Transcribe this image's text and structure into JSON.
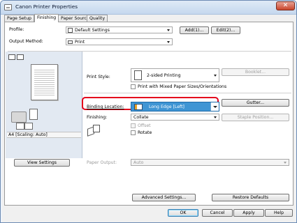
{
  "window": {
    "title": "Canon Printer Properties",
    "close_label": "✕"
  },
  "tabs": [
    {
      "label": "Page Setup"
    },
    {
      "label": "Finishing"
    },
    {
      "label": "Paper Source"
    },
    {
      "label": "Quality"
    }
  ],
  "profile": {
    "label": "Profile:",
    "value": "Default Settings",
    "add_label": "Add(1)...",
    "edit_label": "Edit(2)..."
  },
  "output_method": {
    "label": "Output Method:",
    "value": "Print"
  },
  "print_style": {
    "label": "Print Style:",
    "value": "2-sided Printing",
    "booklet_label": "Booklet..."
  },
  "mixed_paper": {
    "label": "Print with Mixed Paper Sizes/Orientations",
    "checked": false
  },
  "binding": {
    "label": "Binding Location:",
    "value": "Long Edge [Left]",
    "gutter_label": "Gutter..."
  },
  "finishing": {
    "label": "Finishing:",
    "value": "Collate",
    "staple_label": "Staple Position..."
  },
  "offset": {
    "label": "Offset",
    "checked": false
  },
  "rotate": {
    "label": "Rotate",
    "checked": false
  },
  "preview": {
    "caption": "A4 [Scaling: Auto]"
  },
  "view_settings_label": "View Settings",
  "paper_output": {
    "label": "Paper Output:",
    "value": "Auto"
  },
  "advanced_label": "Advanced Settings...",
  "restore_label": "Restore Defaults",
  "footer": {
    "ok": "OK",
    "cancel": "Cancel",
    "apply": "Apply",
    "help": "Help"
  }
}
